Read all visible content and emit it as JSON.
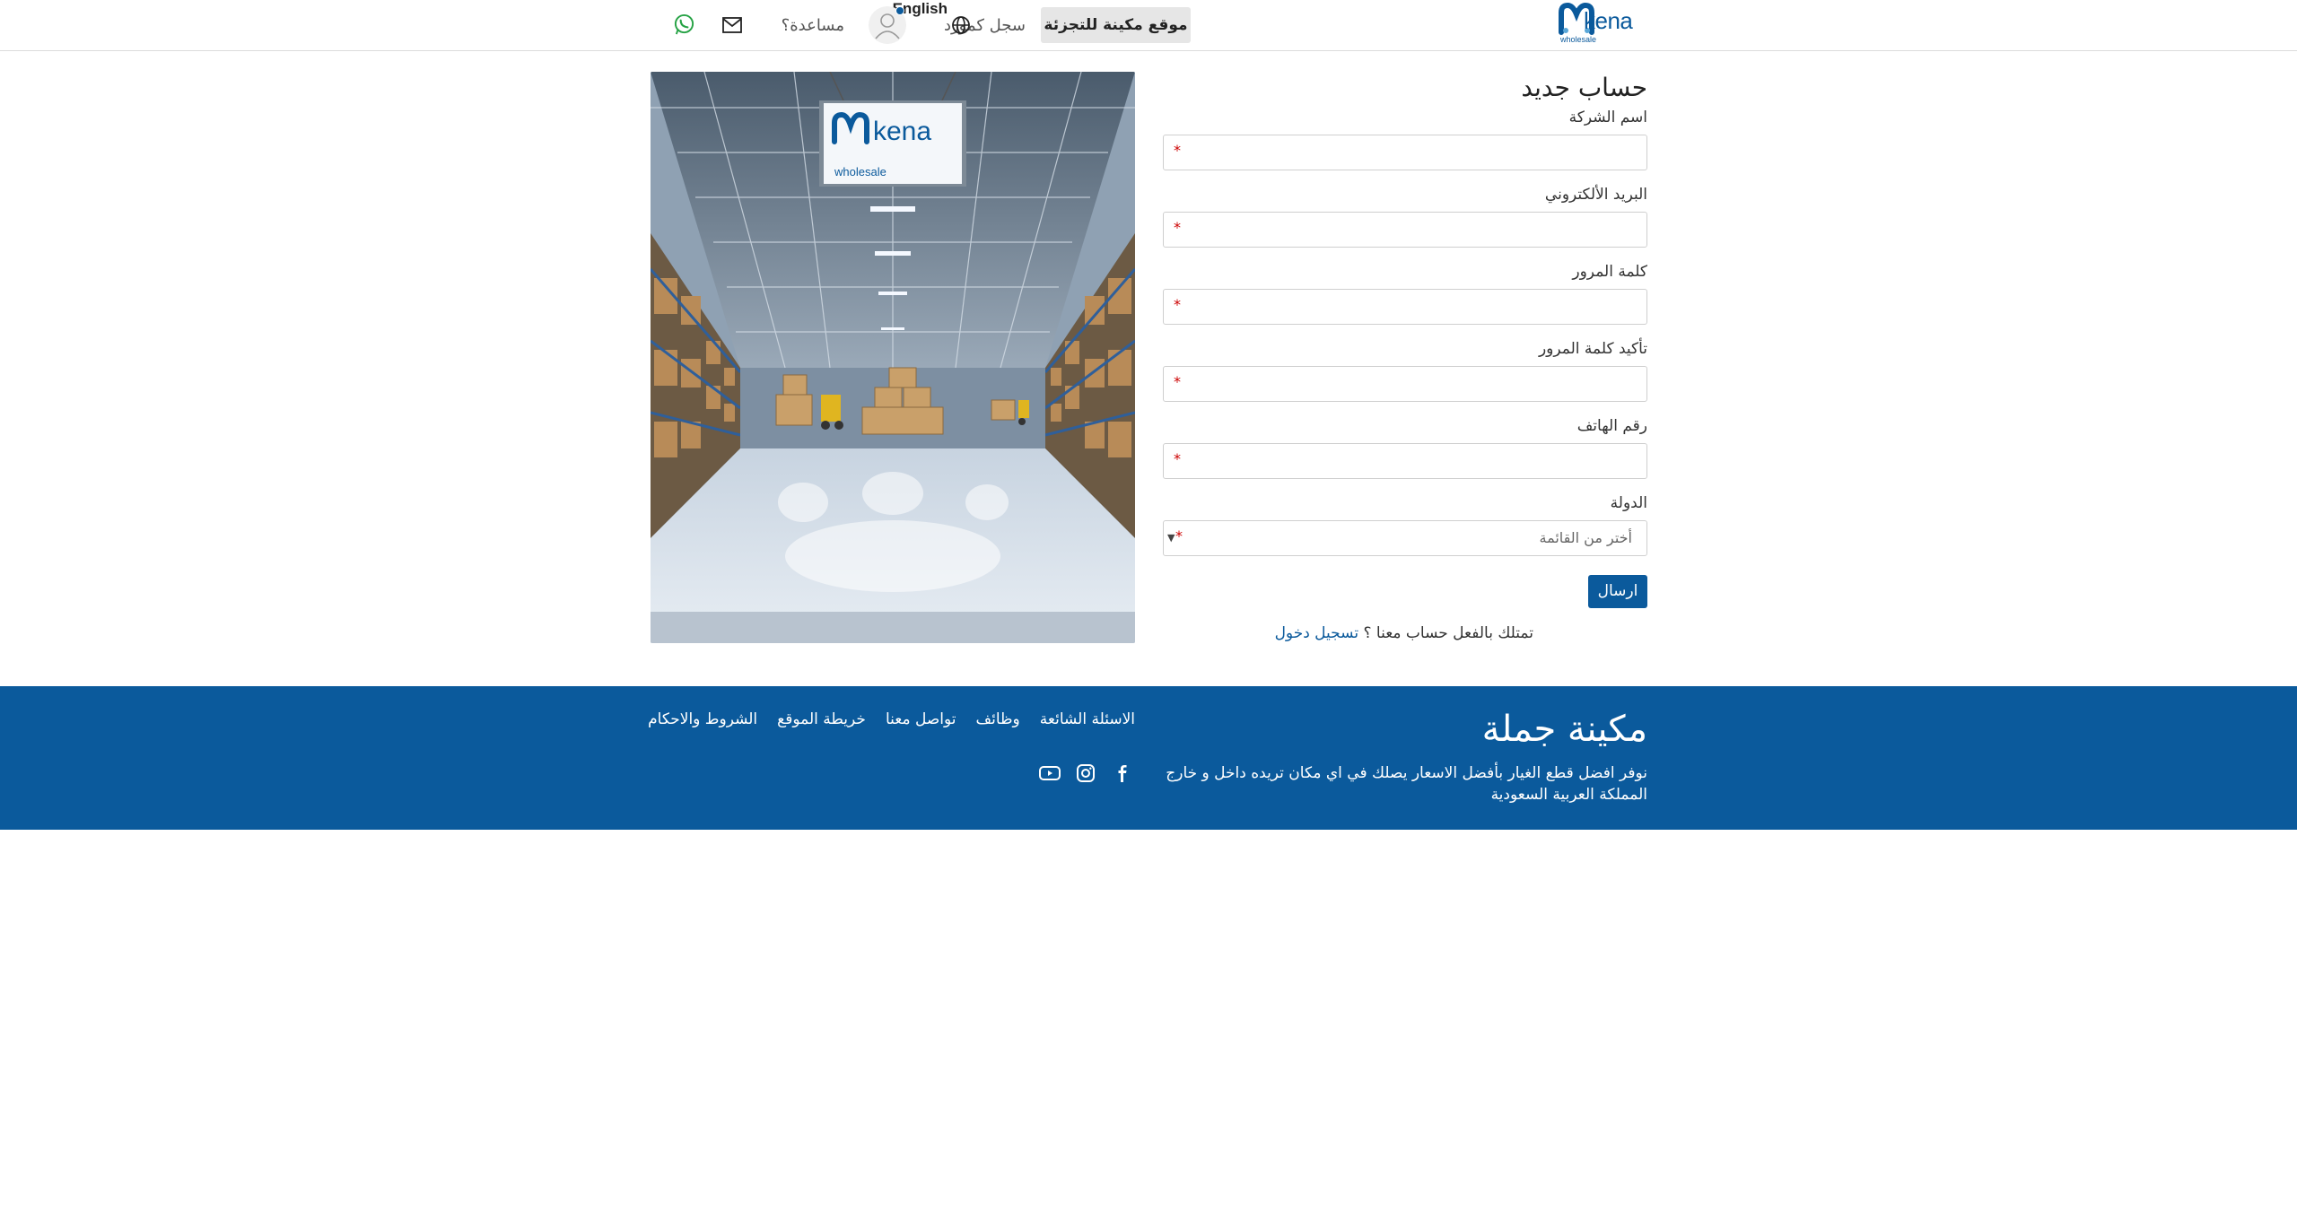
{
  "header": {
    "logo_text": "kena",
    "logo_sub": "wholesale",
    "retail_button": "موقع مكينة للتجزئة",
    "register_link": "سجل كمورد",
    "language": "English",
    "help": "مساعدة؟"
  },
  "form": {
    "title": "حساب جديد",
    "fields": [
      {
        "label": "اسم الشركة",
        "value": "",
        "required": "*"
      },
      {
        "label": "البريد الألكتروني",
        "value": "",
        "required": "*"
      },
      {
        "label": "كلمة المرور",
        "value": "",
        "required": "*"
      },
      {
        "label": "تأكيد كلمة المرور",
        "value": "",
        "required": "*"
      },
      {
        "label": "رقم الهاتف",
        "value": "",
        "required": "*"
      }
    ],
    "country": {
      "label": "الدولة",
      "selected": "أختر من القائمة",
      "required": "*"
    },
    "submit": "ارسال",
    "already_text": "تمتلك بالفعل حساب معنا ؟",
    "login_link": "تسجيل دخول"
  },
  "hero": {
    "sign_text": "kena",
    "sign_sub": "wholesale"
  },
  "footer": {
    "brand": "مكينة جملة",
    "description": "نوفر افضل قطع الغيار بأفضل الاسعار يصلك في اي مكان تريده داخل و خارج المملكة العربية السعودية",
    "links": [
      "الاسئلة الشائعة",
      "وظائف",
      "تواصل معنا",
      "خريطة الموقع",
      "الشروط والاحكام"
    ],
    "social": [
      "facebook-icon",
      "instagram-icon",
      "youtube-icon"
    ]
  },
  "colors": {
    "brand_blue": "#0b5a9c",
    "whatsapp_green": "#25a244",
    "required_red": "#cc0000"
  }
}
